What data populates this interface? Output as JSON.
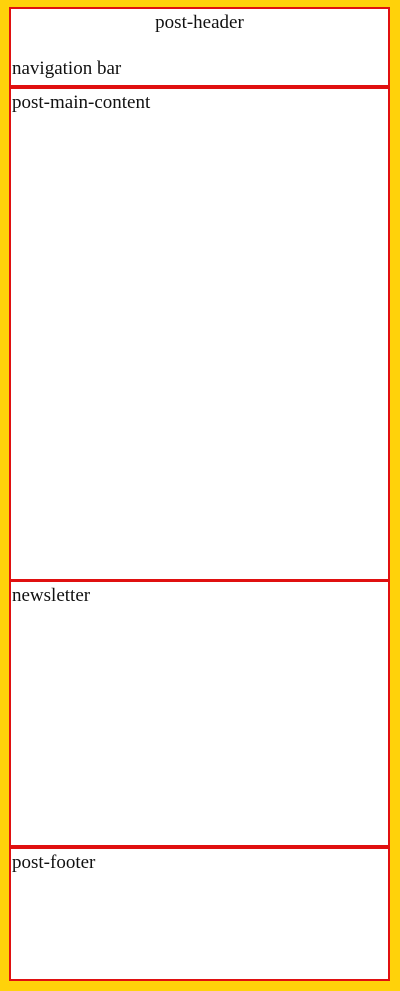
{
  "header": {
    "title": "post-header",
    "nav_label": "navigation bar"
  },
  "main": {
    "label": "post-main-content"
  },
  "newsletter": {
    "label": "newsletter"
  },
  "footer": {
    "label": "post-footer"
  },
  "colors": {
    "background": "#ffd20a",
    "border": "#e01010",
    "panel": "#ffffff",
    "text": "#111111"
  }
}
